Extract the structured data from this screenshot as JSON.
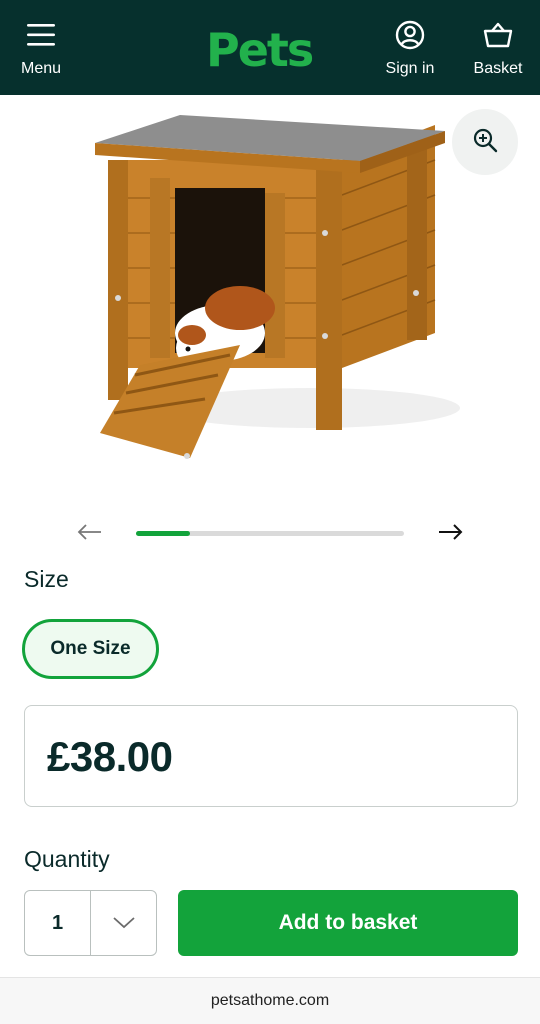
{
  "header": {
    "menu_label": "Menu",
    "logo_text": "Pets",
    "signin_label": "Sign in",
    "basket_label": "Basket"
  },
  "gallery": {
    "zoom_icon": "zoom-in-icon",
    "prev_icon": "arrow-left-icon",
    "next_icon": "arrow-right-icon",
    "progress_fraction": 0.2
  },
  "product": {
    "size_label": "Size",
    "size_option": "One Size",
    "price": "£38.00",
    "quantity_label": "Quantity",
    "quantity_value": "1",
    "add_to_basket_label": "Add to basket"
  },
  "browser": {
    "url": "petsathome.com"
  },
  "colors": {
    "header_bg": "#06302d",
    "brand_green": "#12a33b",
    "text_dark": "#0a2a2a"
  }
}
